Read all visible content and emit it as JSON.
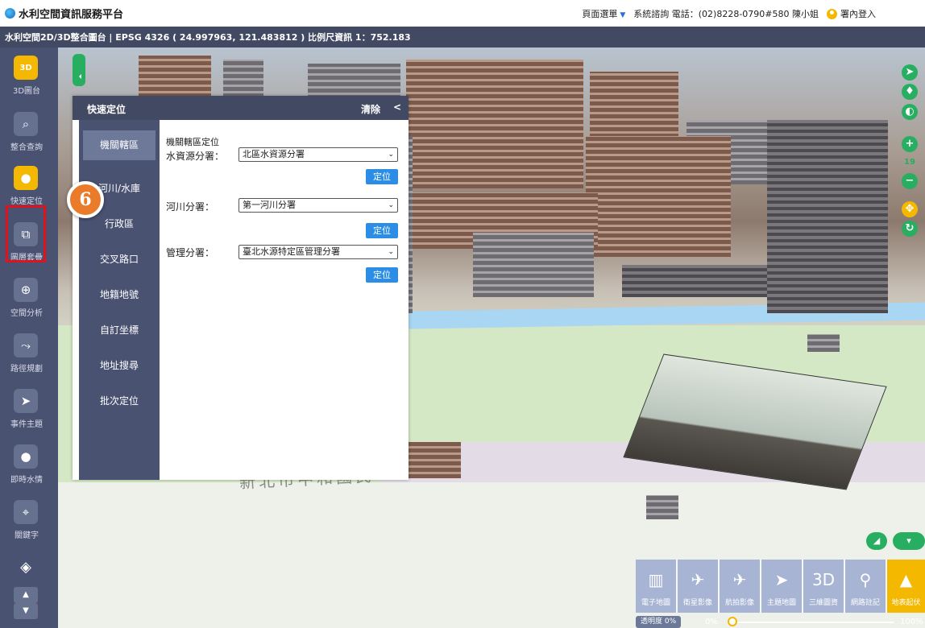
{
  "header": {
    "app_title": "水利空間資訊服務平台",
    "page_menu": "頁面選單",
    "contact": "系統諮詢 電話：(02)8228-0790#580 陳小姐",
    "login": "署內登入"
  },
  "infobar": {
    "text": "水利空間2D/3D整合圖台 | EPSG 4326 ( 24.997963, 121.483812 ) 比例尺資訊 1：752.183"
  },
  "sidebar": {
    "items": [
      {
        "label": "3D圖台",
        "icon": "3d-icon",
        "glyph": "3D"
      },
      {
        "label": "整合查詢",
        "icon": "search-icon",
        "glyph": "⌕"
      },
      {
        "label": "快速定位",
        "icon": "location-pin-icon",
        "glyph": "●"
      },
      {
        "label": "圖層套疊",
        "icon": "layers-icon",
        "glyph": "⧉"
      },
      {
        "label": "空間分析",
        "icon": "globe-icon",
        "glyph": "⊕"
      },
      {
        "label": "路徑規劃",
        "icon": "route-icon",
        "glyph": "⤳"
      },
      {
        "label": "事件主題",
        "icon": "send-icon",
        "glyph": "➤"
      },
      {
        "label": "即時水情",
        "icon": "water-drop-icon",
        "glyph": "●"
      },
      {
        "label": "關鍵字",
        "icon": "keyword-icon",
        "glyph": "⌖"
      }
    ],
    "active_index": 2
  },
  "panel": {
    "title": "快速定位",
    "clear": "清除",
    "collapse": "<",
    "nav": [
      "機關轄區",
      "河川/水庫",
      "行政區",
      "交叉路口",
      "地籍地號",
      "自訂坐標",
      "地址搜尋",
      "批次定位"
    ],
    "nav_active": 0,
    "form_title": "機關轄區定位",
    "fields": [
      {
        "label": "水資源分署：",
        "value": "北區水資源分署",
        "button": "定位"
      },
      {
        "label": "河川分署：",
        "value": "第一河川分署",
        "button": "定位"
      },
      {
        "label": "管理分署：",
        "value": "臺北水源特定區管理分署",
        "button": "定位"
      }
    ]
  },
  "step_badge": "6",
  "map": {
    "zoom_level": "19",
    "text_overlay": "新北市中和國民",
    "basemaps": [
      {
        "label": "電子地圖",
        "icon": "map-icon",
        "glyph": "▥"
      },
      {
        "label": "衛星影像",
        "icon": "satellite-icon",
        "glyph": "✈"
      },
      {
        "label": "航拍影像",
        "icon": "plane-icon",
        "glyph": "✈"
      },
      {
        "label": "主題地圖",
        "icon": "paper-plane-icon",
        "glyph": "➤"
      },
      {
        "label": "三維圖資",
        "icon": "3d-icon",
        "glyph": "3D"
      },
      {
        "label": "網路註記",
        "icon": "map-marker-icon",
        "glyph": "⚲"
      },
      {
        "label": "地表起伏",
        "icon": "terrain-icon",
        "glyph": "▲"
      }
    ],
    "active_basemap": 6,
    "opacity_label": "透明度 0%",
    "opacity_value": "0%",
    "opacity_max": "100%",
    "opacity_fraction": 0
  },
  "colors": {
    "accent": "#f5b800",
    "sidebar_bg": "#4a5272",
    "header_bg": "#424a63",
    "green": "#27ae60",
    "highlight": "#e0121b",
    "badge": "#e97b2b",
    "locate_button": "#2b8de6"
  }
}
